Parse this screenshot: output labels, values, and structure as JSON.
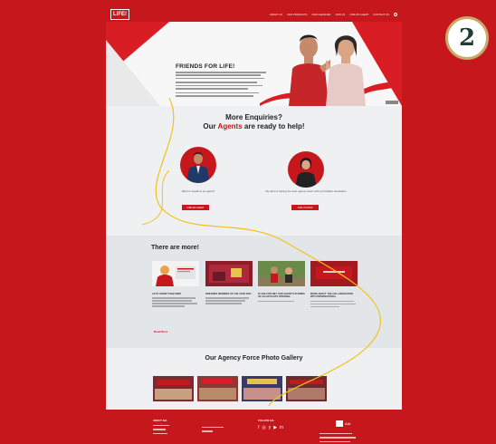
{
  "badge": {
    "number": "2"
  },
  "nav": {
    "logo": "LIFE!",
    "links": [
      "ABOUT US",
      "OUR PRODUCTS",
      "OUR AGENCIES",
      "JOIN US",
      "FIND AN AGENT",
      "CONTACT US"
    ]
  },
  "hero": {
    "title": "FRIENDS FOR LIFE!"
  },
  "enquiries": {
    "title_line1": "More Enquiries?",
    "title_line2_prefix": "Our ",
    "title_line2_highlight": "Agents",
    "title_line2_suffix": " are ready to help!",
    "agent1_caption": "Want to speak to an agent?",
    "agent2_caption": "My pilot of having the best agency team with our brilliant translation",
    "agent1_button": "FIND AN AGENT",
    "agent2_button": "JOIN US NOW"
  },
  "more": {
    "title": "There are more!",
    "cards": [
      {
        "title": "LET'S GROW TOGETHER!"
      },
      {
        "title": "DREAMER WINNERS OF THE YEAR 2021"
      },
      {
        "title": "IS LIFE FOR ME? OUR AGENT'S STORIES OF AIA AFFILIATE INTERNAL"
      },
      {
        "title": "MORE ABOUT THE COLLABORATION WITH INTERNATIONAL"
      }
    ],
    "read_more": "Read More"
  },
  "gallery": {
    "title": "Our Agency Force Photo Gallery"
  },
  "footer": {
    "col1_heading": "ABOUT AIA",
    "col2_heading": "FOLLOW AIA",
    "social": [
      "f",
      "◎",
      "y",
      "▶",
      "in"
    ],
    "brand": "AIA"
  },
  "colors": {
    "brand_red": "#c5171c",
    "badge_border": "#c8a96a",
    "badge_text": "#1f3d34"
  },
  "icons": [
    "search-icon",
    "facebook-icon",
    "instagram-icon",
    "twitter-icon",
    "youtube-icon",
    "linkedin-icon"
  ]
}
